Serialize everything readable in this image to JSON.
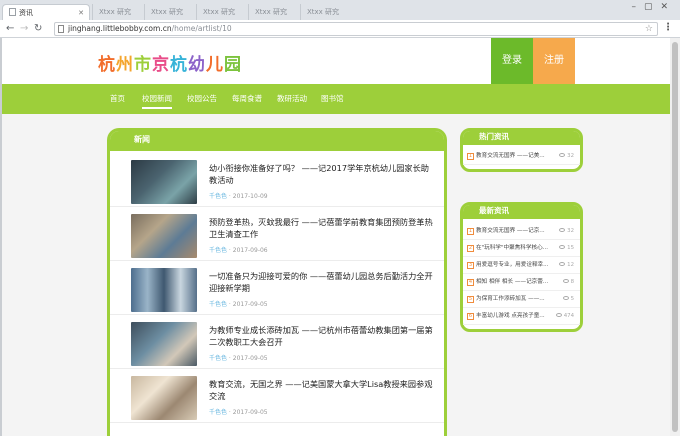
{
  "browser": {
    "tab_title": "资讯",
    "ghost_tabs": [
      "Xtxx 研究",
      "Xtxx 研究",
      "Xtxx 研究",
      "Xtxx 研究",
      "Xtxx 研究"
    ],
    "url_host": "jinghang.littlebobby.com.cn",
    "url_path": "/home/artlist/10"
  },
  "site": {
    "logo_chars": [
      "杭",
      "州",
      "市",
      "京",
      "杭",
      "幼",
      "儿",
      "园"
    ],
    "login_label": "登录",
    "register_label": "注册",
    "nav": [
      "首页",
      "校园新闻",
      "校园公告",
      "每周食谱",
      "教研活动",
      "图书馆"
    ]
  },
  "news": {
    "section_title": "新闻",
    "items": [
      {
        "title": "幼小衔接你准备好了吗？ ——记2017学年京杭幼儿园家长助教活动",
        "category": "千色色",
        "date": "2017-10-09"
      },
      {
        "title": "预防登革热，灭蚊我最行 ——记蓓蕾学前教育集团预防登革热卫生清查工作",
        "category": "千色色",
        "date": "2017-09-06"
      },
      {
        "title": "一切准备只为迎接可爱的你 ——蓓蕾幼儿园总务后勤活力全开迎接新学期",
        "category": "千色色",
        "date": "2017-09-05"
      },
      {
        "title": "为教师专业成长添砖加瓦 ——记杭州市蓓蕾幼教集团第一届第二次教职工大会召开",
        "category": "千色色",
        "date": "2017-09-05"
      },
      {
        "title": "教育交流，无国之界 ——记美国蒙大拿大学Lisa教授来园参观交流",
        "category": "千色色",
        "date": "2017-09-05"
      }
    ]
  },
  "sidebar": {
    "hot_title": "热门资讯",
    "hot": [
      {
        "num": "1",
        "text": "教育交流无国界 ——记美...",
        "views": "32"
      }
    ],
    "latest_title": "最新资讯",
    "latest": [
      {
        "num": "1",
        "text": "教育交流无国界 ——记京...",
        "views": "32"
      },
      {
        "num": "2",
        "text": "在\"玩科学\"中聚焦科学核心...",
        "views": "15"
      },
      {
        "num": "3",
        "text": "用爱逗号专业，用爱诠释幸...",
        "views": "12"
      },
      {
        "num": "4",
        "text": "相知 相伴 相长 ——记京蕾...",
        "views": "8"
      },
      {
        "num": "5",
        "text": "为保育工作添砖加瓦 ——...",
        "views": "5"
      },
      {
        "num": "6",
        "text": "丰富幼儿游戏 点亮孩子童...",
        "views": "474"
      }
    ]
  }
}
